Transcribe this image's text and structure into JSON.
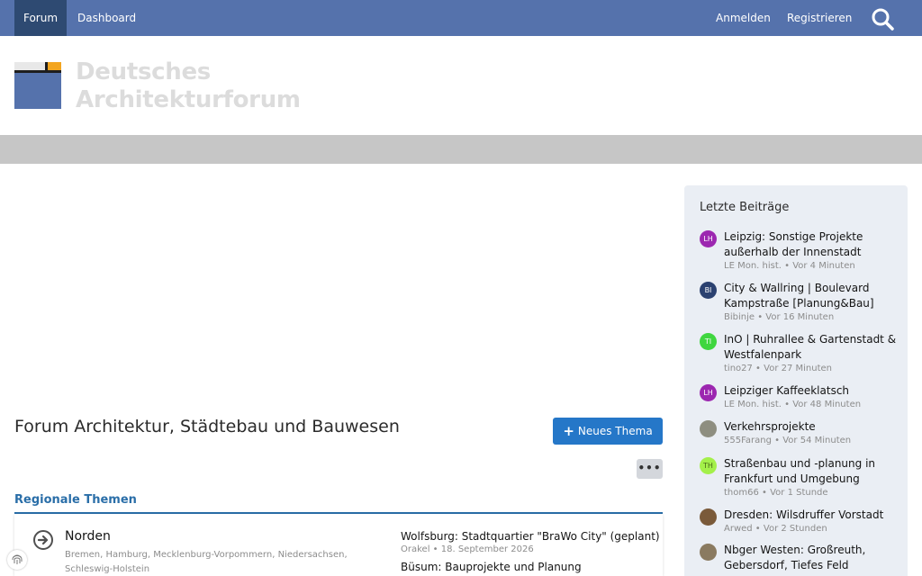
{
  "nav": {
    "forum": "Forum",
    "dashboard": "Dashboard",
    "login": "Anmelden",
    "register": "Registrieren"
  },
  "logo": {
    "line1": "Deutsches",
    "line2": "Architekturforum"
  },
  "page": {
    "title": "Forum Architektur, Städtebau und Bauwesen",
    "new_thread": "Neues Thema",
    "more": "•••"
  },
  "section": {
    "title": "Regionale Themen",
    "forum": {
      "name": "Norden",
      "desc": "Bremen, Hamburg, Mecklenburg-Vorpommern, Niedersachsen, Schleswig-Holstein",
      "latest_title": "Wolfsburg: Stadtquartier \"BraWo City\" (geplant)",
      "latest_meta": "Orakel • 18. September 2026",
      "latest_title2": "Büsum: Bauprojekte und Planung"
    }
  },
  "sidebar": {
    "title": "Letzte Beiträge",
    "posts": [
      {
        "initials": "LH",
        "color": "#9c27b0",
        "title": "Leipzig: Sonstige Projekte außerhalb der Innenstadt",
        "meta": "LE Mon. hist. • Vor 4 Minuten"
      },
      {
        "initials": "BI",
        "color": "#2b4170",
        "title": "City & Wallring | Boulevard Kampstraße [Planung&Bau]",
        "meta": "Bibinje • Vor 16 Minuten"
      },
      {
        "initials": "TI",
        "color": "#3fd63f",
        "title": "InO | Ruhrallee & Gartenstadt & Westfalenpark",
        "meta": "tino27 • Vor 27 Minuten"
      },
      {
        "initials": "LH",
        "color": "#9c27b0",
        "title": "Leipziger Kaffeeklatsch",
        "meta": "LE Mon. hist. • Vor 48 Minuten"
      },
      {
        "initials": "",
        "color": "#8e8e80",
        "title": "Verkehrsprojekte",
        "meta": "555Farang • Vor 54 Minuten"
      },
      {
        "initials": "TH",
        "color": "#a4f04a",
        "title": "Straßenbau und -planung in Frankfurt und Umgebung",
        "meta": "thom66 • Vor 1 Stunde"
      },
      {
        "initials": "",
        "color": "#7a5a3a",
        "title": "Dresden: Wilsdruffer Vorstadt",
        "meta": "Arwed • Vor 2 Stunden"
      },
      {
        "initials": "",
        "color": "#8a7a60",
        "title": "Nbger Westen: Großreuth, Gebersdorf, Tiefes Feld",
        "meta": ""
      }
    ]
  },
  "colors": {
    "nav_bg": "#5572ac",
    "nav_active": "#2e4a72",
    "accent": "#2577c8",
    "section": "#2a6ea8",
    "sidebar_bg": "#eaeef4"
  }
}
